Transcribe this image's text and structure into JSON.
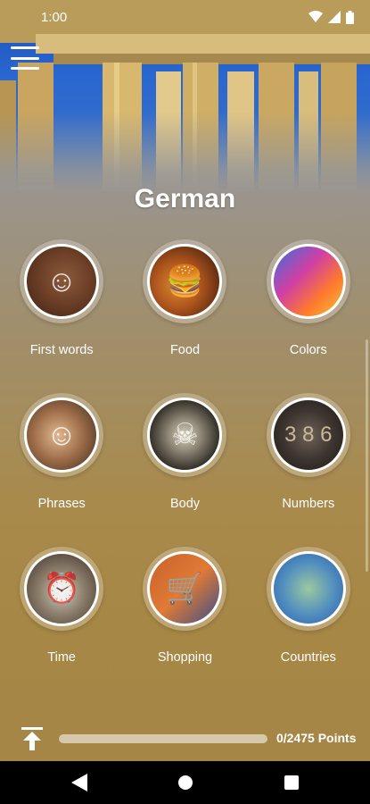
{
  "status": {
    "time": "1:00"
  },
  "header": {
    "title": "German"
  },
  "categories": [
    {
      "label": "First words",
      "icon": "child-photo"
    },
    {
      "label": "Food",
      "icon": "burger-photo"
    },
    {
      "label": "Colors",
      "icon": "paint-powder-photo"
    },
    {
      "label": "Phrases",
      "icon": "woman-smiling-photo"
    },
    {
      "label": "Body",
      "icon": "skeleton-photo"
    },
    {
      "label": "Numbers",
      "icon": "metal-numbers-photo"
    },
    {
      "label": "Time",
      "icon": "alarm-clock-photo"
    },
    {
      "label": "Shopping",
      "icon": "shopping-cart-photo"
    },
    {
      "label": "Countries",
      "icon": "map-photo"
    }
  ],
  "progress": {
    "points_text": "0/2475 Points",
    "value": 0
  },
  "colors": {
    "accent": "#a78745",
    "sky": "#2a67d0"
  }
}
